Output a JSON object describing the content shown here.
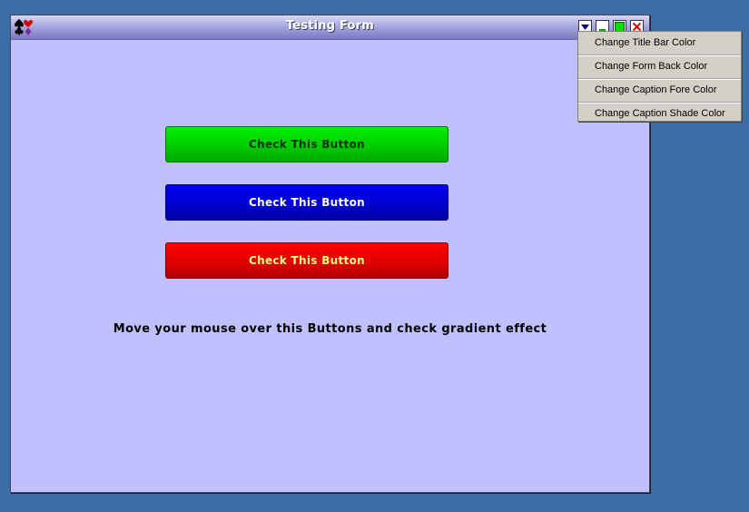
{
  "window": {
    "title": "Testing Form",
    "icons": {
      "app": "card-suits-icon",
      "menu": "dropdown-arrow-icon",
      "minimize": "minimize-icon",
      "maximize": "maximize-icon",
      "close": "close-icon"
    },
    "colors": {
      "form_back": "#c0c0ff",
      "title_gradient_top": "#d8d8f4",
      "title_gradient_bottom": "#7878c0",
      "desktop": "#3a6ea5"
    }
  },
  "buttons": [
    {
      "label": "Check This Button",
      "color": "green",
      "gradient": "#00cc00"
    },
    {
      "label": "Check This Button",
      "color": "blue",
      "gradient": "#0000d0"
    },
    {
      "label": "Check This Button",
      "color": "red",
      "gradient": "#e00000"
    }
  ],
  "instruction": "Move your mouse over this Buttons and check gradient effect",
  "context_menu": {
    "items": [
      "Change Title Bar Color",
      "Change Form Back Color",
      "Change Caption Fore Color",
      "Change Caption Shade Color"
    ]
  }
}
